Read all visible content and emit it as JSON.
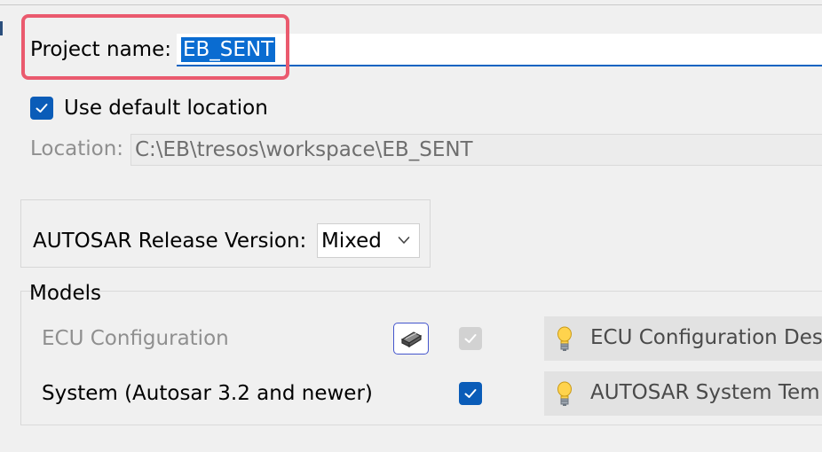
{
  "project": {
    "label": "Project name:",
    "value": "EB_SENT"
  },
  "default_location": {
    "label": "Use default location",
    "checked": true
  },
  "location": {
    "label": "Location:",
    "value": "C:\\EB\\tresos\\workspace\\EB_SENT"
  },
  "autosar": {
    "label": "AUTOSAR Release Version:",
    "selected": "Mixed"
  },
  "models": {
    "title": "Models",
    "rows": [
      {
        "label": "ECU Configuration",
        "enabled": false,
        "icon": "chip-icon",
        "checked": true,
        "description": "ECU Configuration Des"
      },
      {
        "label": "System (Autosar 3.2 and newer)",
        "enabled": true,
        "checked": true,
        "description": "AUTOSAR System Tem"
      }
    ]
  },
  "colors": {
    "highlight_border": "#ea5a6e",
    "selection_bg": "#0a6cd1",
    "checkbox_blue": "#0a5cb8",
    "disabled_text": "#8f8f8f"
  }
}
